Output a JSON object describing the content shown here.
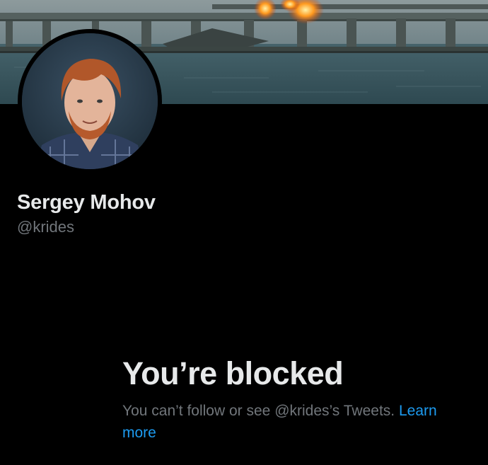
{
  "profile": {
    "display_name": "Sergey Mohov",
    "handle": "@krides"
  },
  "blocked": {
    "title": "You’re blocked",
    "description": "You can’t follow or see @krides’s Tweets.",
    "learn_more": "Learn more"
  },
  "colors": {
    "background": "#000000",
    "primary_text": "#e7e9ea",
    "secondary_text": "#71767b",
    "link": "#1d9bf0"
  }
}
